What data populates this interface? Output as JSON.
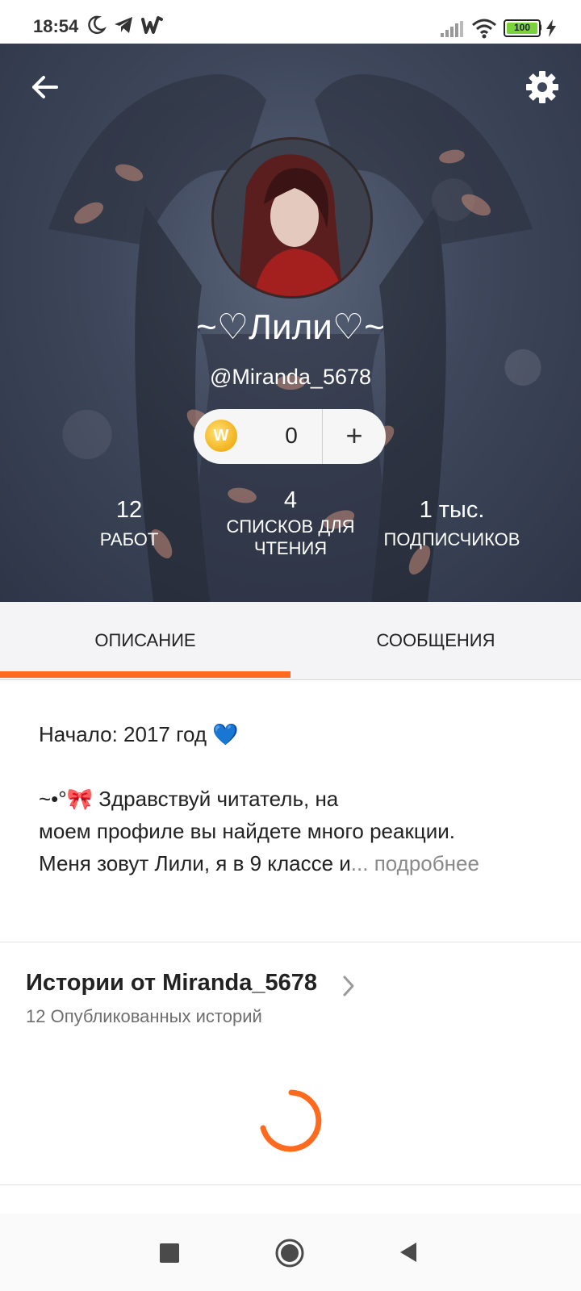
{
  "status_bar": {
    "time": "18:54",
    "battery": "100",
    "icons": [
      "moon-icon",
      "telegram-icon",
      "wattpad-icon",
      "signal-icon",
      "wifi-icon",
      "battery-icon",
      "charging-icon"
    ]
  },
  "header": {
    "display_name": "~♡Лили♡~",
    "username": "@Miranda_5678",
    "coins": {
      "count": "0",
      "add_label": "+",
      "coin_letter": "W"
    },
    "stats": [
      {
        "value": "12",
        "label": "РАБОТ"
      },
      {
        "value": "4",
        "label_line1": "СПИСКОВ ДЛЯ",
        "label_line2": "ЧТЕНИЯ"
      },
      {
        "value": "1 тыс.",
        "label": "ПОДПИСЧИКОВ"
      }
    ]
  },
  "tabs": [
    {
      "label": "ОПИСАНИЕ",
      "active": true
    },
    {
      "label": "СООБЩЕНИЯ",
      "active": false
    }
  ],
  "description": {
    "line1": "Начало: 2017 год 💙",
    "line2": "~•°🎀 Здравствуй читатель, на",
    "line3": "моем профиле вы найдете много реакции.",
    "line4": "Меня зовут Лили, я в 9 классе и",
    "more": "... подробнее"
  },
  "stories": {
    "title": "Истории от Miranda_5678",
    "subtitle": "12 Опубликованных историй"
  },
  "colors": {
    "accent": "#ff6a1f",
    "tab_bg": "#f4f3f5"
  }
}
